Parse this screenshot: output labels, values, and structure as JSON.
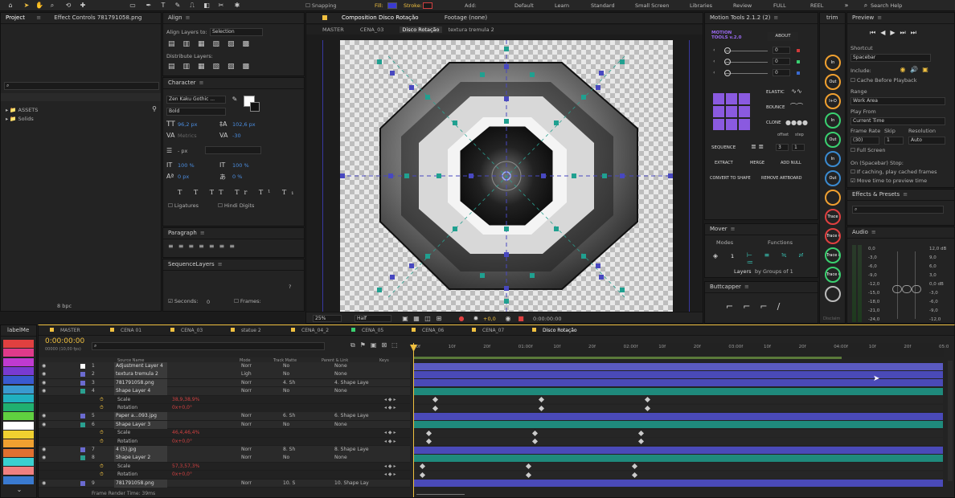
{
  "topbar": {
    "snapping": "Snapping",
    "fill": "Fill:",
    "stroke": "Stroke:",
    "add": "Add:",
    "workspaces": [
      "Default",
      "Learn",
      "Standard",
      "Small Screen",
      "Libraries",
      "Review",
      "FULL",
      "REEL"
    ],
    "search": "Search Help"
  },
  "project": {
    "tab1": "Project",
    "tab2": "Effect Controls 781791058.png",
    "folders": [
      "ASSETS",
      "Solids"
    ],
    "bpc": "8 bpc"
  },
  "align": {
    "title": "Align",
    "align_to_label": "Align Layers to:",
    "align_to_value": "Selection",
    "distribute": "Distribute Layers:"
  },
  "character": {
    "title": "Character",
    "font": "Zen Kaku Gothic ...",
    "style": "Bold",
    "size": "96,2 px",
    "leading": "102,6 px",
    "kerning": "Metrics",
    "tracking": "-30",
    "stroke_width": "- px",
    "vscale": "100 %",
    "hscale": "100 %",
    "baseline": "0 px",
    "tsume": "0 %",
    "ligatures": "Ligatures",
    "hindi": "Hindi Digits"
  },
  "paragraph": {
    "title": "Paragraph"
  },
  "sequence": {
    "title": "SequenceLayers",
    "seconds": "Seconds:",
    "seconds_val": "0",
    "frames": "Frames:",
    "help": "?"
  },
  "composition": {
    "tab": "Composition Disco Rotação",
    "footage": "Footage (none)",
    "breadcrumbs": [
      "MASTER",
      "CENA_03",
      "Disco Rotação",
      "textura tremula 2"
    ],
    "zoom": "25%",
    "quality": "Half",
    "time": "0:00:00:00",
    "exposure": "+0,0"
  },
  "motion": {
    "title": "Motion Tools 2.1.2 (2)",
    "logo1": "MOTION",
    "logo2": "TOOLS v.2.0",
    "about": "ABOUT",
    "val1": "0",
    "val2": "0",
    "val3": "0",
    "elastic": "ELASTIC",
    "bounce": "BOUNCE",
    "clone": "CLONE",
    "offset": "offset",
    "step": "step",
    "sequence": "SEQUENCE",
    "seq1": "3",
    "seq2": "1",
    "extract": "EXTRACT",
    "merge": "MERGE",
    "add_null": "ADD NULL",
    "convert": "CONVERT TO SHAPE",
    "remove": "REMOVE ARTBOARD"
  },
  "mover": {
    "title": "Mover",
    "modes": "Modes",
    "functions": "Functions",
    "count": "1",
    "layers_label": "Layers",
    "groups": "by Groups of 1"
  },
  "buttcapper": {
    "title": "Buttcapper"
  },
  "trim": {
    "title": "trim",
    "buttons": [
      "In",
      "Out",
      "I+O",
      "In",
      "Out",
      "In",
      "Out",
      "",
      "Trace",
      "Trace Out",
      "Trace In",
      "Trace Out",
      ""
    ],
    "footer": "Disclaim"
  },
  "preview": {
    "title": "Preview",
    "shortcut": "Shortcut",
    "shortcut_val": "Spacebar",
    "include": "Include:",
    "cache": "Cache Before Playback",
    "range": "Range",
    "range_val": "Work Area",
    "play_from": "Play From",
    "play_from_val": "Current Time",
    "frame_rate": "Frame Rate",
    "skip": "Skip",
    "resolution": "Resolution",
    "fr_val": "(30)",
    "skip_val": "1",
    "res_val": "Auto",
    "full": "Full Screen",
    "on_stop": "On (Spacebar) Stop:",
    "if_caching": "If caching, play cached frames",
    "move_time": "Move time to preview time"
  },
  "effects": {
    "title": "Effects & Presets"
  },
  "audio": {
    "title": "Audio",
    "left": [
      "0,0",
      "-3,0",
      "-6,0",
      "-9,0",
      "-12,0",
      "-15,0",
      "-18,0",
      "-21,0",
      "-24,0"
    ],
    "right": [
      "12,0 dB",
      "9,0",
      "6,0",
      "3,0",
      "0,0 dB",
      "-3,0",
      "-6,0",
      "-9,0",
      "-12,0"
    ]
  },
  "labels": {
    "title": "labelMe",
    "colors": [
      "#e04040",
      "#e03a8a",
      "#c03ad0",
      "#7a3ad0",
      "#3a5ad0",
      "#3a9ad0",
      "#20b0c0",
      "#20b070",
      "#60d040",
      "#ffffff",
      "#f0d030",
      "#f0a030",
      "#e07030",
      "#3ad0d0",
      "#f08080",
      "#3a7ad0"
    ]
  },
  "timeline": {
    "tabs": [
      "MASTER",
      "CENA 01",
      "CENA_03",
      "statue 2",
      "CENA_04_2",
      "CENA_05",
      "CENA_06",
      "CENA_07",
      "Disco Rotação"
    ],
    "timecode": "0:00:00:00",
    "timecode_sub": "00000 (10,00 fps)",
    "col_source": "Source Name",
    "col_mode": "Mode",
    "col_track": "Track Matte",
    "col_parent": "Parent & Link",
    "col_keys": "Keys",
    "ruler": [
      "00f",
      "10f",
      "20f",
      "01:00f",
      "10f",
      "20f",
      "02:00f",
      "10f",
      "20f",
      "03:00f",
      "10f",
      "20f",
      "04:00f",
      "10f",
      "20f",
      "05:0"
    ],
    "render": "Frame Render Time:",
    "render_val": "39ms",
    "layers": [
      {
        "num": "1",
        "name": "Adjustment Layer 4",
        "mode": "Norr",
        "matte": "No",
        "parent": "None",
        "type": "layer",
        "color": "#ffffff"
      },
      {
        "num": "2",
        "name": "textura tremula 2",
        "mode": "Ligh",
        "matte": "No",
        "parent": "None",
        "type": "layer",
        "color": "#6b6bd0"
      },
      {
        "num": "3",
        "name": "781791058.png",
        "mode": "Norr",
        "matte": "4. Sh",
        "parent": "4. Shape Laye",
        "type": "layer",
        "color": "#6b6bd0"
      },
      {
        "num": "4",
        "name": "Shape Layer 4",
        "mode": "Norr",
        "matte": "No",
        "parent": "None",
        "type": "layer",
        "color": "#2aa090"
      },
      {
        "num": "",
        "name": "Scale",
        "mode": "",
        "matte": "",
        "parent": "",
        "type": "prop",
        "value": "38,9,38,9%"
      },
      {
        "num": "",
        "name": "Rotation",
        "mode": "",
        "matte": "",
        "parent": "",
        "type": "prop",
        "value": "0x+0,0°"
      },
      {
        "num": "5",
        "name": "Paper a...093.jpg",
        "mode": "Norr",
        "matte": "6. Sh",
        "parent": "6. Shape Laye",
        "type": "layer",
        "color": "#6b6bd0"
      },
      {
        "num": "6",
        "name": "Shape Layer 3",
        "mode": "Norr",
        "matte": "No",
        "parent": "None",
        "type": "layer",
        "color": "#2aa090"
      },
      {
        "num": "",
        "name": "Scale",
        "mode": "",
        "matte": "",
        "parent": "",
        "type": "prop",
        "value": "46,4,46,4%"
      },
      {
        "num": "",
        "name": "Rotation",
        "mode": "",
        "matte": "",
        "parent": "",
        "type": "prop",
        "value": "0x+0,0°"
      },
      {
        "num": "7",
        "name": "4 (5).jpg",
        "mode": "Norr",
        "matte": "8. Sh",
        "parent": "8. Shape Laye",
        "type": "layer",
        "color": "#6b6bd0"
      },
      {
        "num": "8",
        "name": "Shape Layer 2",
        "mode": "Norr",
        "matte": "No",
        "parent": "None",
        "type": "layer",
        "color": "#2aa090"
      },
      {
        "num": "",
        "name": "Scale",
        "mode": "",
        "matte": "",
        "parent": "",
        "type": "prop",
        "value": "57,3,57,3%"
      },
      {
        "num": "",
        "name": "Rotation",
        "mode": "",
        "matte": "",
        "parent": "",
        "type": "prop",
        "value": "0x+0,0°"
      },
      {
        "num": "9",
        "name": "781791058.png",
        "mode": "Norr",
        "matte": "10. S",
        "parent": "10. Shape Lay",
        "type": "layer",
        "color": "#6b6bd0"
      }
    ]
  }
}
